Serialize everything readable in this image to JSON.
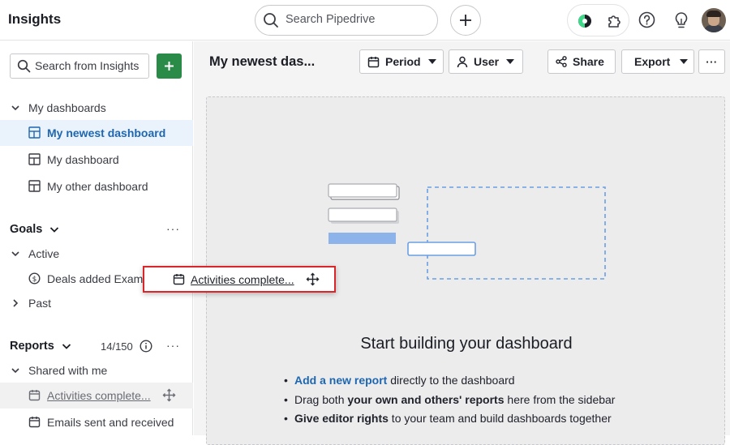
{
  "header": {
    "app_title": "Insights",
    "search_placeholder": "Search Pipedrive",
    "icons": [
      "search-icon",
      "plus-icon",
      "sales-assistant-icon",
      "puzzle-icon",
      "help-icon",
      "lightbulb-icon",
      "avatar"
    ]
  },
  "sidebar": {
    "search_placeholder": "Search from Insights",
    "add_label": "+",
    "dashboards": {
      "header": "My dashboards",
      "items": [
        {
          "label": "My newest dashboard",
          "active": true
        },
        {
          "label": "My dashboard"
        },
        {
          "label": "My other dashboard"
        }
      ]
    },
    "goals": {
      "header": "Goals",
      "more": "···",
      "active_group": "Active",
      "active_item": "Deals added Example t...",
      "past_group": "Past"
    },
    "reports": {
      "header": "Reports",
      "count": "14/150",
      "more": "···",
      "shared_group": "Shared with me",
      "items": [
        {
          "label": "Activities complete...",
          "dragging": true
        },
        {
          "label": "Emails sent and received"
        }
      ]
    }
  },
  "main": {
    "dashboard_title": "My newest das...",
    "toolbar": {
      "period_label": "Period",
      "user_label": "User",
      "share_label": "Share",
      "export_label": "Export",
      "more_label": "···"
    },
    "empty_state": {
      "title": "Start building your dashboard",
      "tip1_link": "Add a new report",
      "tip1_rest": " directly to the dashboard",
      "tip2_a": "Drag both ",
      "tip2_bold": "your own and others' reports",
      "tip2_b": " here from the sidebar",
      "tip3_bold": "Give editor rights",
      "tip3_rest": " to your team and build dashboards together"
    }
  },
  "drag_chip": {
    "label": "Activities complete..."
  },
  "colors": {
    "accent_blue": "#1e67b0",
    "add_green": "#2a8a48",
    "highlight_red": "#d8262b",
    "illustration_blue": "#8db4ea"
  }
}
